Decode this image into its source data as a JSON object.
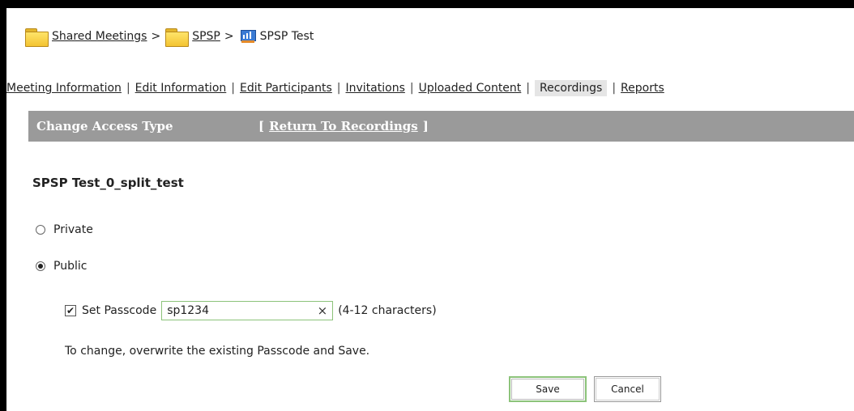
{
  "breadcrumb": {
    "items": [
      "Shared Meetings",
      "SPSP",
      "SPSP Test"
    ],
    "separator": ">"
  },
  "tabs": {
    "items": [
      "Meeting Information",
      "Edit Information",
      "Edit Participants",
      "Invitations",
      "Uploaded Content",
      "Recordings",
      "Reports"
    ],
    "active": "Recordings"
  },
  "header": {
    "title": "Change Access Type",
    "return_link": "Return To Recordings",
    "bracket_open": "[",
    "bracket_close": "]"
  },
  "recording": {
    "name": "SPSP Test_0_split_test"
  },
  "access": {
    "private_label": "Private",
    "public_label": "Public",
    "selected": "Public"
  },
  "passcode": {
    "label": "Set Passcode",
    "checked": true,
    "value": "sp1234",
    "hint": "(4-12 characters)",
    "clear_symbol": "×"
  },
  "note": "To change, overwrite the existing Passcode and Save.",
  "buttons": {
    "save": "Save",
    "cancel": "Cancel"
  },
  "colors": {
    "header_bar": "#9a9a9a",
    "input_border": "#8cc37a",
    "active_tab": "#e5e5e5"
  }
}
